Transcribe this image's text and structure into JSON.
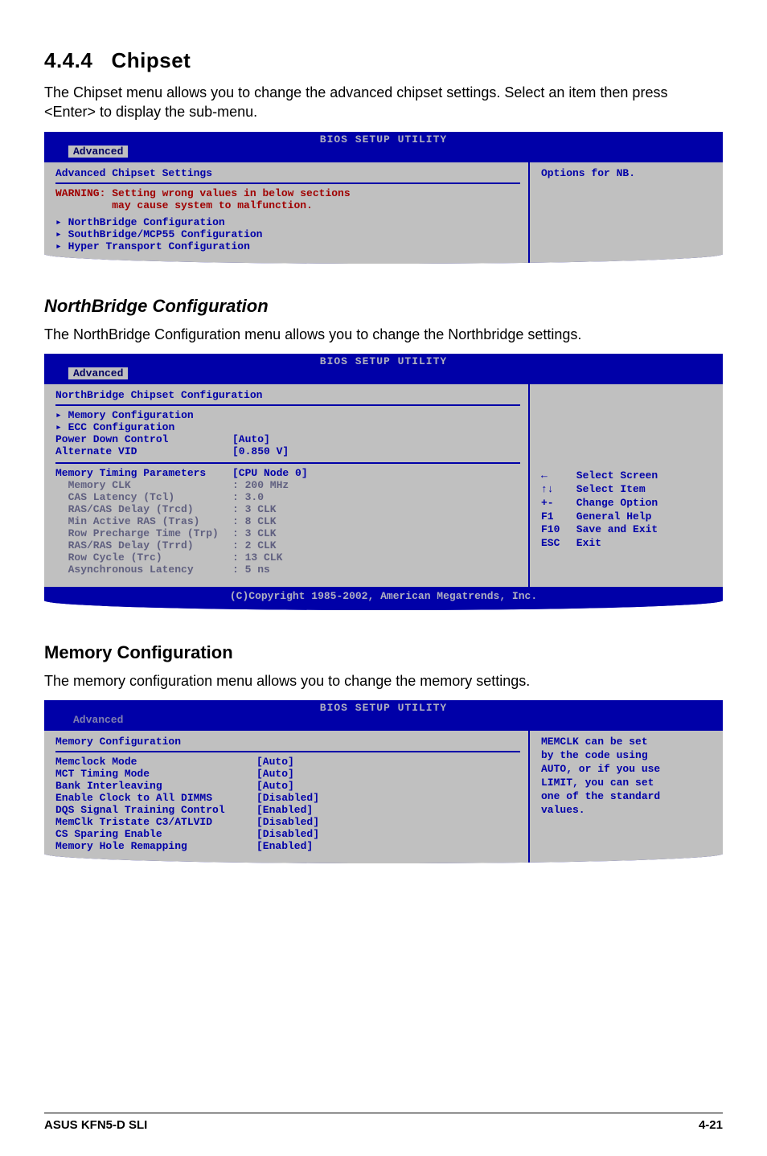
{
  "section": {
    "number": "4.4.4",
    "title": "Chipset",
    "intro": "The Chipset menu allows you to change the advanced chipset settings. Select an item then press <Enter> to display the sub-menu."
  },
  "bios_common": {
    "title": "BIOS SETUP UTILITY",
    "tab": "Advanced",
    "copyright": "(C)Copyright 1985-2002, American Megatrends, Inc."
  },
  "panel1": {
    "heading": "Advanced Chipset Settings",
    "warning": "WARNING: Setting wrong values in below sections\n         may cause system to malfunction.",
    "items": [
      "NorthBridge Configuration",
      "SouthBridge/MCP55 Configuration",
      "Hyper Transport Configuration"
    ],
    "help": "Options for NB."
  },
  "northbridge": {
    "heading": "NorthBridge Configuration",
    "intro": "The NorthBridge Configuration menu allows you to change the Northbridge settings."
  },
  "panel2": {
    "heading": "NorthBridge Chipset Configuration",
    "submenus": [
      "Memory Configuration",
      "ECC Configuration"
    ],
    "fields": [
      {
        "label": "Power Down Control",
        "value": "[Auto]"
      },
      {
        "label": "Alternate VID",
        "value": "[0.850 V]"
      }
    ],
    "timing_header": {
      "label": "Memory Timing Parameters",
      "value": "[CPU Node 0]"
    },
    "timing_rows": [
      {
        "label": "Memory CLK",
        "value": ": 200 MHz"
      },
      {
        "label": "CAS Latency (Tcl)",
        "value": ": 3.0"
      },
      {
        "label": "RAS/CAS Delay (Trcd)",
        "value": ": 3 CLK"
      },
      {
        "label": "Min Active RAS (Tras)",
        "value": ": 8 CLK"
      },
      {
        "label": "Row Precharge Time (Trp)",
        "value": ": 3 CLK"
      },
      {
        "label": "RAS/RAS Delay (Trrd)",
        "value": ": 2 CLK"
      },
      {
        "label": "Row Cycle (Trc)",
        "value": ": 13 CLK"
      },
      {
        "label": "Asynchronous Latency",
        "value": ": 5 ns"
      }
    ],
    "help": [
      {
        "key": "←",
        "text": "Select Screen"
      },
      {
        "key": "↑↓",
        "text": "Select Item"
      },
      {
        "key": "+-",
        "text": "Change Option"
      },
      {
        "key": "F1",
        "text": "General Help"
      },
      {
        "key": "F10",
        "text": "Save and Exit"
      },
      {
        "key": "ESC",
        "text": "Exit"
      }
    ]
  },
  "memory": {
    "heading": "Memory Configuration",
    "intro": "The memory configuration menu allows you to change the memory settings."
  },
  "panel3": {
    "heading": "Memory Configuration",
    "fields": [
      {
        "label": "Memclock Mode",
        "value": "[Auto]"
      },
      {
        "label": "MCT Timing Mode",
        "value": "[Auto]"
      },
      {
        "label": "Bank Interleaving",
        "value": "[Auto]"
      },
      {
        "label": "Enable Clock to All DIMMS",
        "value": "[Disabled]"
      },
      {
        "label": "DQS Signal Training Control",
        "value": "[Enabled]"
      },
      {
        "label": "MemClk Tristate C3/ATLVID",
        "value": "[Disabled]"
      },
      {
        "label": "CS Sparing Enable",
        "value": "[Disabled]"
      },
      {
        "label": "Memory Hole Remapping",
        "value": "[Enabled]"
      }
    ],
    "help": "MEMCLK can be set\nby the code using\nAUTO, or if you use\nLIMIT, you can set\none of the standard\nvalues."
  },
  "footer": {
    "left": "ASUS KFN5-D SLI",
    "right": "4-21"
  }
}
